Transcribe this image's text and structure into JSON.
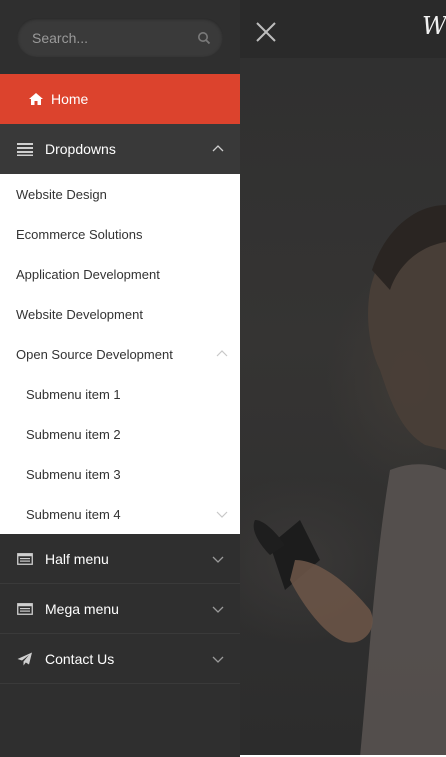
{
  "search": {
    "placeholder": "Search..."
  },
  "nav": {
    "home": {
      "label": "Home",
      "icon": "home-icon"
    },
    "dropdowns": {
      "label": "Dropdowns",
      "icon": "list-icon",
      "expanded": true
    },
    "dropdown_items": [
      {
        "label": "Website Design"
      },
      {
        "label": "Ecommerce Solutions"
      },
      {
        "label": "Application Development"
      },
      {
        "label": "Website Development"
      },
      {
        "label": "Open Source Development",
        "expanded": true
      }
    ],
    "submenu_items": [
      {
        "label": "Submenu item 1"
      },
      {
        "label": "Submenu item 2"
      },
      {
        "label": "Submenu item 3"
      },
      {
        "label": "Submenu item 4"
      }
    ],
    "half_menu": {
      "label": "Half menu",
      "icon": "window-icon"
    },
    "mega_menu": {
      "label": "Mega menu",
      "icon": "window-icon"
    },
    "contact": {
      "label": "Contact Us",
      "icon": "paper-plane-icon"
    }
  },
  "brand": {
    "text": "W"
  },
  "colors": {
    "accent": "#dc432d",
    "sidebar_bg": "#2f2f2f",
    "active_bg": "#393939",
    "submenu_bg": "#ffffff"
  }
}
